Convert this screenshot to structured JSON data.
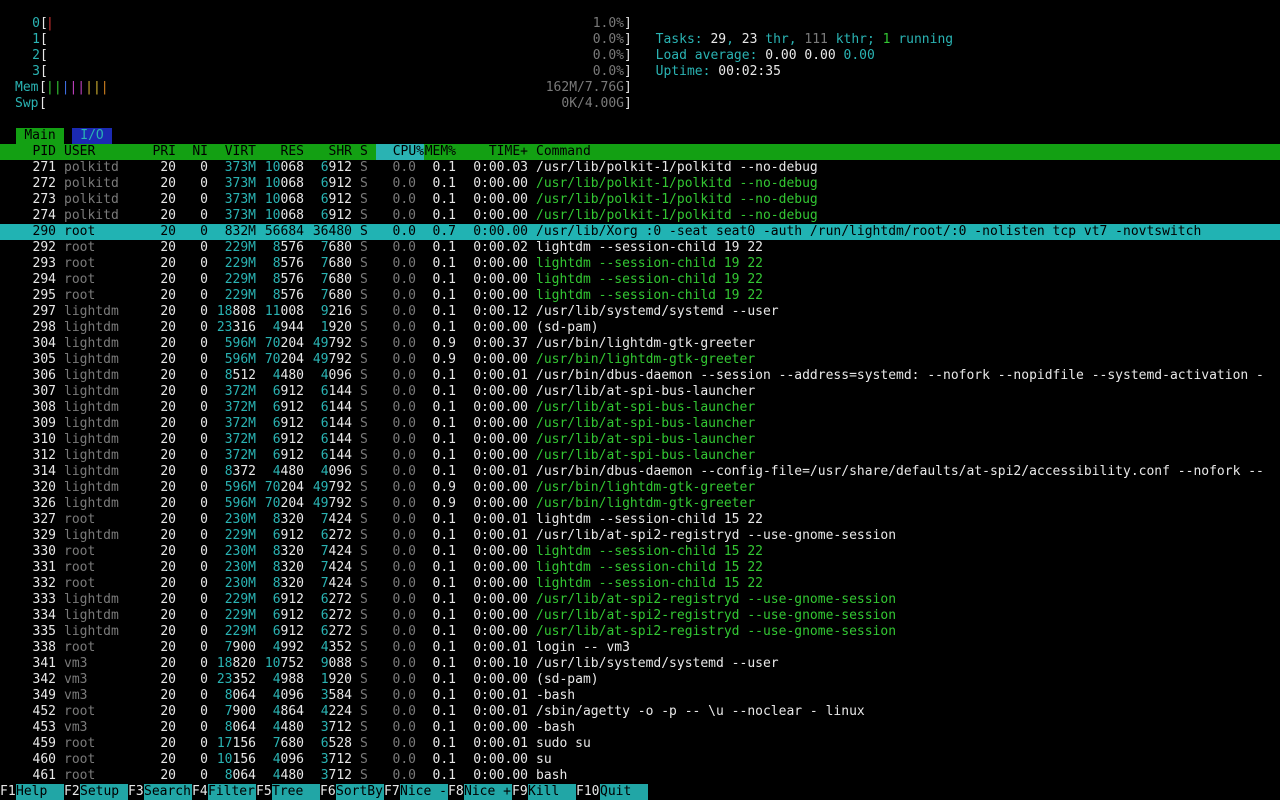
{
  "cpus": [
    {
      "label": "0",
      "pct": "1.0%"
    },
    {
      "label": "1",
      "pct": "0.0%"
    },
    {
      "label": "2",
      "pct": "0.0%"
    },
    {
      "label": "3",
      "pct": "0.0%"
    }
  ],
  "mem": {
    "label": "Mem",
    "value": "162M/7.76G"
  },
  "swp": {
    "label": "Swp",
    "value": "0K/4.00G"
  },
  "tasks": {
    "label": "Tasks: ",
    "count": "29",
    "sep1": ", ",
    "thr": "23",
    "thr_label": " thr, ",
    "kthr": "111",
    "kthr_label": " kthr; ",
    "running": "1",
    "running_label": " running"
  },
  "load": {
    "label": "Load average: ",
    "v1": "0.00",
    "v5": "0.00",
    "v15": "0.00"
  },
  "uptime": {
    "label": "Uptime: ",
    "value": "00:02:35"
  },
  "tabs": [
    {
      "label": "Main"
    },
    {
      "label": "I/O"
    }
  ],
  "columns": {
    "pid": "PID",
    "user": "USER",
    "pri": "PRI",
    "ni": "NI",
    "virt": "VIRT",
    "res": "RES",
    "shr": "SHR",
    "s": "S",
    "cpu": "CPU%",
    "mem": "MEM%",
    "time": "TIME+",
    "command": "Command"
  },
  "processes": [
    {
      "pid": "271",
      "user": "polkitd",
      "pri": "20",
      "ni": "0",
      "virt": "373M",
      "res": "10068",
      "shr": "6912",
      "s": "S",
      "cpu": "0.0",
      "mem": "0.1",
      "time": "0:00.03",
      "command": "/usr/lib/polkit-1/polkitd --no-debug",
      "thread": false
    },
    {
      "pid": "272",
      "user": "polkitd",
      "pri": "20",
      "ni": "0",
      "virt": "373M",
      "res": "10068",
      "shr": "6912",
      "s": "S",
      "cpu": "0.0",
      "mem": "0.1",
      "time": "0:00.00",
      "command": "/usr/lib/polkit-1/polkitd --no-debug",
      "thread": true
    },
    {
      "pid": "273",
      "user": "polkitd",
      "pri": "20",
      "ni": "0",
      "virt": "373M",
      "res": "10068",
      "shr": "6912",
      "s": "S",
      "cpu": "0.0",
      "mem": "0.1",
      "time": "0:00.00",
      "command": "/usr/lib/polkit-1/polkitd --no-debug",
      "thread": true
    },
    {
      "pid": "274",
      "user": "polkitd",
      "pri": "20",
      "ni": "0",
      "virt": "373M",
      "res": "10068",
      "shr": "6912",
      "s": "S",
      "cpu": "0.0",
      "mem": "0.1",
      "time": "0:00.00",
      "command": "/usr/lib/polkit-1/polkitd --no-debug",
      "thread": true
    },
    {
      "pid": "290",
      "user": "root",
      "pri": "20",
      "ni": "0",
      "virt": "832M",
      "res": "56684",
      "shr": "36480",
      "s": "S",
      "cpu": "0.0",
      "mem": "0.7",
      "time": "0:00.00",
      "command": "/usr/lib/Xorg :0 -seat seat0 -auth /run/lightdm/root/:0 -nolisten tcp vt7 -novtswitch",
      "thread": false,
      "selected": true
    },
    {
      "pid": "292",
      "user": "root",
      "pri": "20",
      "ni": "0",
      "virt": "229M",
      "res": "8576",
      "shr": "7680",
      "s": "S",
      "cpu": "0.0",
      "mem": "0.1",
      "time": "0:00.02",
      "command": "lightdm --session-child 19 22",
      "thread": false
    },
    {
      "pid": "293",
      "user": "root",
      "pri": "20",
      "ni": "0",
      "virt": "229M",
      "res": "8576",
      "shr": "7680",
      "s": "S",
      "cpu": "0.0",
      "mem": "0.1",
      "time": "0:00.00",
      "command": "lightdm --session-child 19 22",
      "thread": true
    },
    {
      "pid": "294",
      "user": "root",
      "pri": "20",
      "ni": "0",
      "virt": "229M",
      "res": "8576",
      "shr": "7680",
      "s": "S",
      "cpu": "0.0",
      "mem": "0.1",
      "time": "0:00.00",
      "command": "lightdm --session-child 19 22",
      "thread": true
    },
    {
      "pid": "295",
      "user": "root",
      "pri": "20",
      "ni": "0",
      "virt": "229M",
      "res": "8576",
      "shr": "7680",
      "s": "S",
      "cpu": "0.0",
      "mem": "0.1",
      "time": "0:00.00",
      "command": "lightdm --session-child 19 22",
      "thread": true
    },
    {
      "pid": "297",
      "user": "lightdm",
      "pri": "20",
      "ni": "0",
      "virt": "18808",
      "res": "11008",
      "shr": "9216",
      "s": "S",
      "cpu": "0.0",
      "mem": "0.1",
      "time": "0:00.12",
      "command": "/usr/lib/systemd/systemd --user",
      "thread": false
    },
    {
      "pid": "298",
      "user": "lightdm",
      "pri": "20",
      "ni": "0",
      "virt": "23316",
      "res": "4944",
      "shr": "1920",
      "s": "S",
      "cpu": "0.0",
      "mem": "0.1",
      "time": "0:00.00",
      "command": "(sd-pam)",
      "thread": false
    },
    {
      "pid": "304",
      "user": "lightdm",
      "pri": "20",
      "ni": "0",
      "virt": "596M",
      "res": "70204",
      "shr": "49792",
      "s": "S",
      "cpu": "0.0",
      "mem": "0.9",
      "time": "0:00.37",
      "command": "/usr/bin/lightdm-gtk-greeter",
      "thread": false
    },
    {
      "pid": "305",
      "user": "lightdm",
      "pri": "20",
      "ni": "0",
      "virt": "596M",
      "res": "70204",
      "shr": "49792",
      "s": "S",
      "cpu": "0.0",
      "mem": "0.9",
      "time": "0:00.00",
      "command": "/usr/bin/lightdm-gtk-greeter",
      "thread": true
    },
    {
      "pid": "306",
      "user": "lightdm",
      "pri": "20",
      "ni": "0",
      "virt": "8512",
      "res": "4480",
      "shr": "4096",
      "s": "S",
      "cpu": "0.0",
      "mem": "0.1",
      "time": "0:00.01",
      "command": "/usr/bin/dbus-daemon --session --address=systemd: --nofork --nopidfile --systemd-activation -",
      "thread": false
    },
    {
      "pid": "307",
      "user": "lightdm",
      "pri": "20",
      "ni": "0",
      "virt": "372M",
      "res": "6912",
      "shr": "6144",
      "s": "S",
      "cpu": "0.0",
      "mem": "0.1",
      "time": "0:00.00",
      "command": "/usr/lib/at-spi-bus-launcher",
      "thread": false
    },
    {
      "pid": "308",
      "user": "lightdm",
      "pri": "20",
      "ni": "0",
      "virt": "372M",
      "res": "6912",
      "shr": "6144",
      "s": "S",
      "cpu": "0.0",
      "mem": "0.1",
      "time": "0:00.00",
      "command": "/usr/lib/at-spi-bus-launcher",
      "thread": true
    },
    {
      "pid": "309",
      "user": "lightdm",
      "pri": "20",
      "ni": "0",
      "virt": "372M",
      "res": "6912",
      "shr": "6144",
      "s": "S",
      "cpu": "0.0",
      "mem": "0.1",
      "time": "0:00.00",
      "command": "/usr/lib/at-spi-bus-launcher",
      "thread": true
    },
    {
      "pid": "310",
      "user": "lightdm",
      "pri": "20",
      "ni": "0",
      "virt": "372M",
      "res": "6912",
      "shr": "6144",
      "s": "S",
      "cpu": "0.0",
      "mem": "0.1",
      "time": "0:00.00",
      "command": "/usr/lib/at-spi-bus-launcher",
      "thread": true
    },
    {
      "pid": "312",
      "user": "lightdm",
      "pri": "20",
      "ni": "0",
      "virt": "372M",
      "res": "6912",
      "shr": "6144",
      "s": "S",
      "cpu": "0.0",
      "mem": "0.1",
      "time": "0:00.00",
      "command": "/usr/lib/at-spi-bus-launcher",
      "thread": true
    },
    {
      "pid": "314",
      "user": "lightdm",
      "pri": "20",
      "ni": "0",
      "virt": "8372",
      "res": "4480",
      "shr": "4096",
      "s": "S",
      "cpu": "0.0",
      "mem": "0.1",
      "time": "0:00.01",
      "command": "/usr/bin/dbus-daemon --config-file=/usr/share/defaults/at-spi2/accessibility.conf --nofork --",
      "thread": false
    },
    {
      "pid": "320",
      "user": "lightdm",
      "pri": "20",
      "ni": "0",
      "virt": "596M",
      "res": "70204",
      "shr": "49792",
      "s": "S",
      "cpu": "0.0",
      "mem": "0.9",
      "time": "0:00.00",
      "command": "/usr/bin/lightdm-gtk-greeter",
      "thread": true
    },
    {
      "pid": "326",
      "user": "lightdm",
      "pri": "20",
      "ni": "0",
      "virt": "596M",
      "res": "70204",
      "shr": "49792",
      "s": "S",
      "cpu": "0.0",
      "mem": "0.9",
      "time": "0:00.00",
      "command": "/usr/bin/lightdm-gtk-greeter",
      "thread": true
    },
    {
      "pid": "327",
      "user": "root",
      "pri": "20",
      "ni": "0",
      "virt": "230M",
      "res": "8320",
      "shr": "7424",
      "s": "S",
      "cpu": "0.0",
      "mem": "0.1",
      "time": "0:00.01",
      "command": "lightdm --session-child 15 22",
      "thread": false
    },
    {
      "pid": "329",
      "user": "lightdm",
      "pri": "20",
      "ni": "0",
      "virt": "229M",
      "res": "6912",
      "shr": "6272",
      "s": "S",
      "cpu": "0.0",
      "mem": "0.1",
      "time": "0:00.01",
      "command": "/usr/lib/at-spi2-registryd --use-gnome-session",
      "thread": false
    },
    {
      "pid": "330",
      "user": "root",
      "pri": "20",
      "ni": "0",
      "virt": "230M",
      "res": "8320",
      "shr": "7424",
      "s": "S",
      "cpu": "0.0",
      "mem": "0.1",
      "time": "0:00.00",
      "command": "lightdm --session-child 15 22",
      "thread": true
    },
    {
      "pid": "331",
      "user": "root",
      "pri": "20",
      "ni": "0",
      "virt": "230M",
      "res": "8320",
      "shr": "7424",
      "s": "S",
      "cpu": "0.0",
      "mem": "0.1",
      "time": "0:00.00",
      "command": "lightdm --session-child 15 22",
      "thread": true
    },
    {
      "pid": "332",
      "user": "root",
      "pri": "20",
      "ni": "0",
      "virt": "230M",
      "res": "8320",
      "shr": "7424",
      "s": "S",
      "cpu": "0.0",
      "mem": "0.1",
      "time": "0:00.00",
      "command": "lightdm --session-child 15 22",
      "thread": true
    },
    {
      "pid": "333",
      "user": "lightdm",
      "pri": "20",
      "ni": "0",
      "virt": "229M",
      "res": "6912",
      "shr": "6272",
      "s": "S",
      "cpu": "0.0",
      "mem": "0.1",
      "time": "0:00.00",
      "command": "/usr/lib/at-spi2-registryd --use-gnome-session",
      "thread": true
    },
    {
      "pid": "334",
      "user": "lightdm",
      "pri": "20",
      "ni": "0",
      "virt": "229M",
      "res": "6912",
      "shr": "6272",
      "s": "S",
      "cpu": "0.0",
      "mem": "0.1",
      "time": "0:00.00",
      "command": "/usr/lib/at-spi2-registryd --use-gnome-session",
      "thread": true
    },
    {
      "pid": "335",
      "user": "lightdm",
      "pri": "20",
      "ni": "0",
      "virt": "229M",
      "res": "6912",
      "shr": "6272",
      "s": "S",
      "cpu": "0.0",
      "mem": "0.1",
      "time": "0:00.00",
      "command": "/usr/lib/at-spi2-registryd --use-gnome-session",
      "thread": true
    },
    {
      "pid": "338",
      "user": "root",
      "pri": "20",
      "ni": "0",
      "virt": "7900",
      "res": "4992",
      "shr": "4352",
      "s": "S",
      "cpu": "0.0",
      "mem": "0.1",
      "time": "0:00.01",
      "command": "login -- vm3",
      "thread": false
    },
    {
      "pid": "341",
      "user": "vm3",
      "pri": "20",
      "ni": "0",
      "virt": "18820",
      "res": "10752",
      "shr": "9088",
      "s": "S",
      "cpu": "0.0",
      "mem": "0.1",
      "time": "0:00.10",
      "command": "/usr/lib/systemd/systemd --user",
      "thread": false
    },
    {
      "pid": "342",
      "user": "vm3",
      "pri": "20",
      "ni": "0",
      "virt": "23352",
      "res": "4988",
      "shr": "1920",
      "s": "S",
      "cpu": "0.0",
      "mem": "0.1",
      "time": "0:00.00",
      "command": "(sd-pam)",
      "thread": false
    },
    {
      "pid": "349",
      "user": "vm3",
      "pri": "20",
      "ni": "0",
      "virt": "8064",
      "res": "4096",
      "shr": "3584",
      "s": "S",
      "cpu": "0.0",
      "mem": "0.1",
      "time": "0:00.01",
      "command": "-bash",
      "thread": false
    },
    {
      "pid": "452",
      "user": "root",
      "pri": "20",
      "ni": "0",
      "virt": "7900",
      "res": "4864",
      "shr": "4224",
      "s": "S",
      "cpu": "0.0",
      "mem": "0.1",
      "time": "0:00.01",
      "command": "/sbin/agetty -o -p -- \\u --noclear - linux",
      "thread": false
    },
    {
      "pid": "453",
      "user": "vm3",
      "pri": "20",
      "ni": "0",
      "virt": "8064",
      "res": "4480",
      "shr": "3712",
      "s": "S",
      "cpu": "0.0",
      "mem": "0.1",
      "time": "0:00.00",
      "command": "-bash",
      "thread": false
    },
    {
      "pid": "459",
      "user": "root",
      "pri": "20",
      "ni": "0",
      "virt": "17156",
      "res": "7680",
      "shr": "6528",
      "s": "S",
      "cpu": "0.0",
      "mem": "0.1",
      "time": "0:00.01",
      "command": "sudo su",
      "thread": false
    },
    {
      "pid": "460",
      "user": "root",
      "pri": "20",
      "ni": "0",
      "virt": "10156",
      "res": "4096",
      "shr": "3712",
      "s": "S",
      "cpu": "0.0",
      "mem": "0.1",
      "time": "0:00.00",
      "command": "su",
      "thread": false
    },
    {
      "pid": "461",
      "user": "root",
      "pri": "20",
      "ni": "0",
      "virt": "8064",
      "res": "4480",
      "shr": "3712",
      "s": "S",
      "cpu": "0.0",
      "mem": "0.1",
      "time": "0:00.00",
      "command": "bash",
      "thread": false
    }
  ],
  "fkeys": [
    {
      "key": "F1",
      "label": "Help"
    },
    {
      "key": "F2",
      "label": "Setup"
    },
    {
      "key": "F3",
      "label": "Search"
    },
    {
      "key": "F4",
      "label": "Filter"
    },
    {
      "key": "F5",
      "label": "Tree"
    },
    {
      "key": "F6",
      "label": "SortBy"
    },
    {
      "key": "F7",
      "label": "Nice -"
    },
    {
      "key": "F8",
      "label": "Nice +"
    },
    {
      "key": "F9",
      "label": "Kill"
    },
    {
      "key": "F10",
      "label": "Quit"
    }
  ]
}
